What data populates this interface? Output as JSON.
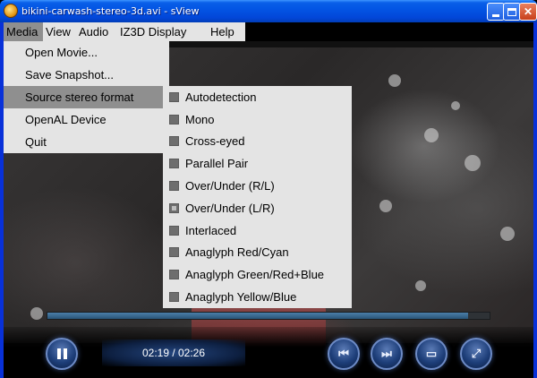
{
  "window": {
    "title": "bikini-carwash-stereo-3d.avi - sView",
    "icon": "sview-app-icon"
  },
  "menubar": {
    "items": [
      "Media",
      "View",
      "Audio",
      "IZ3D Display",
      "Help"
    ],
    "active": "Media"
  },
  "media_menu": {
    "items": [
      "Open Movie...",
      "Save Snapshot...",
      "Source stereo format",
      "OpenAL Device",
      "Quit"
    ],
    "highlighted": "Source stereo format"
  },
  "stereo_submenu": {
    "items": [
      "Autodetection",
      "Mono",
      "Cross-eyed",
      "Parallel Pair",
      "Over/Under (R/L)",
      "Over/Under (L/R)",
      "Interlaced",
      "Anaglyph Red/Cyan",
      "Anaglyph Green/Red+Blue",
      "Anaglyph Yellow/Blue"
    ],
    "checked": "Over/Under (L/R)"
  },
  "player": {
    "time_display": "02:19 / 02:26",
    "seek_progress": 0.952,
    "buttons": [
      "pause-icon",
      "previous-icon",
      "next-icon",
      "screen-icon",
      "fullscreen-icon"
    ]
  },
  "colors": {
    "title_bar": "#0355e4",
    "menu_bg": "#e4e4e4",
    "menu_highlight": "#8f8f8f",
    "seek_fill": "#3a6a90"
  }
}
